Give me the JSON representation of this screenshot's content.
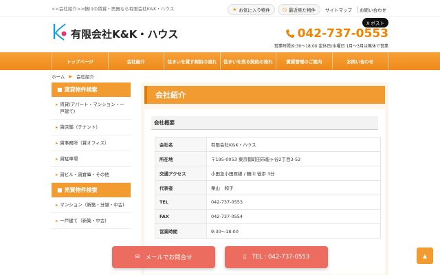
{
  "topbar": {
    "breadcrumb_text": "<<会社紹介>>鶴川の賃貸・売買なら有限会社K&K・ハウス",
    "favorites_label": "お気に入り物件",
    "recent_label": "最近見た物件",
    "sitemap_label": "サイトマップ",
    "contact_label": "お問い合わせ"
  },
  "header": {
    "company_name": "有限会社K&K・ハウス",
    "tweet_label": "X ポスト",
    "phone": "042-737-0553",
    "hours": "営業時間/9:30～18:00 定休日/水曜日 1月～3月は無休で営業"
  },
  "gnav": [
    "トップページ",
    "会社紹介",
    "住まいを貸す契約の流れ",
    "住まいを売る契約の流れ",
    "賃貸管理のご案内",
    "お問い合わせ"
  ],
  "breadcrumb": {
    "home": "ホーム",
    "current": "会社紹介"
  },
  "sidebar": {
    "rent_heading": "賃貸物件検索",
    "rent_items": [
      "賃貸(アパート・マンション・一戸建て)",
      "貸店舗（テナント）",
      "貸事務所（貸オフィス）",
      "貸駐車場",
      "貸ビル・貸倉庫・その他"
    ],
    "sale_heading": "売買物件検索",
    "sale_items": [
      "マンション（新築・分譲・中古)",
      "一戸建て（新築・中古)"
    ]
  },
  "main": {
    "title": "会社紹介",
    "section": "会社概要",
    "rows": [
      {
        "k": "会社名",
        "v": "有限会社K&K・ハウス"
      },
      {
        "k": "所在地",
        "v": "〒195-0053 東京都町田市能ヶ谷2丁目3-52"
      },
      {
        "k": "交通アクセス",
        "v": "小田急小田原線 / 鶴川 徒歩 3分"
      },
      {
        "k": "代表者",
        "v": "栗山　和子"
      },
      {
        "k": "TEL",
        "v": "042-737-0553"
      },
      {
        "k": "FAX",
        "v": "042-737-0554"
      },
      {
        "k": "営業時間",
        "v": "9:30～18:00"
      }
    ]
  },
  "cta": {
    "mail": "メールでお問合せ",
    "tel": "TEL : 042-737-0553"
  },
  "colors": {
    "accent": "#f29b30",
    "cta": "#ec6d5f"
  }
}
